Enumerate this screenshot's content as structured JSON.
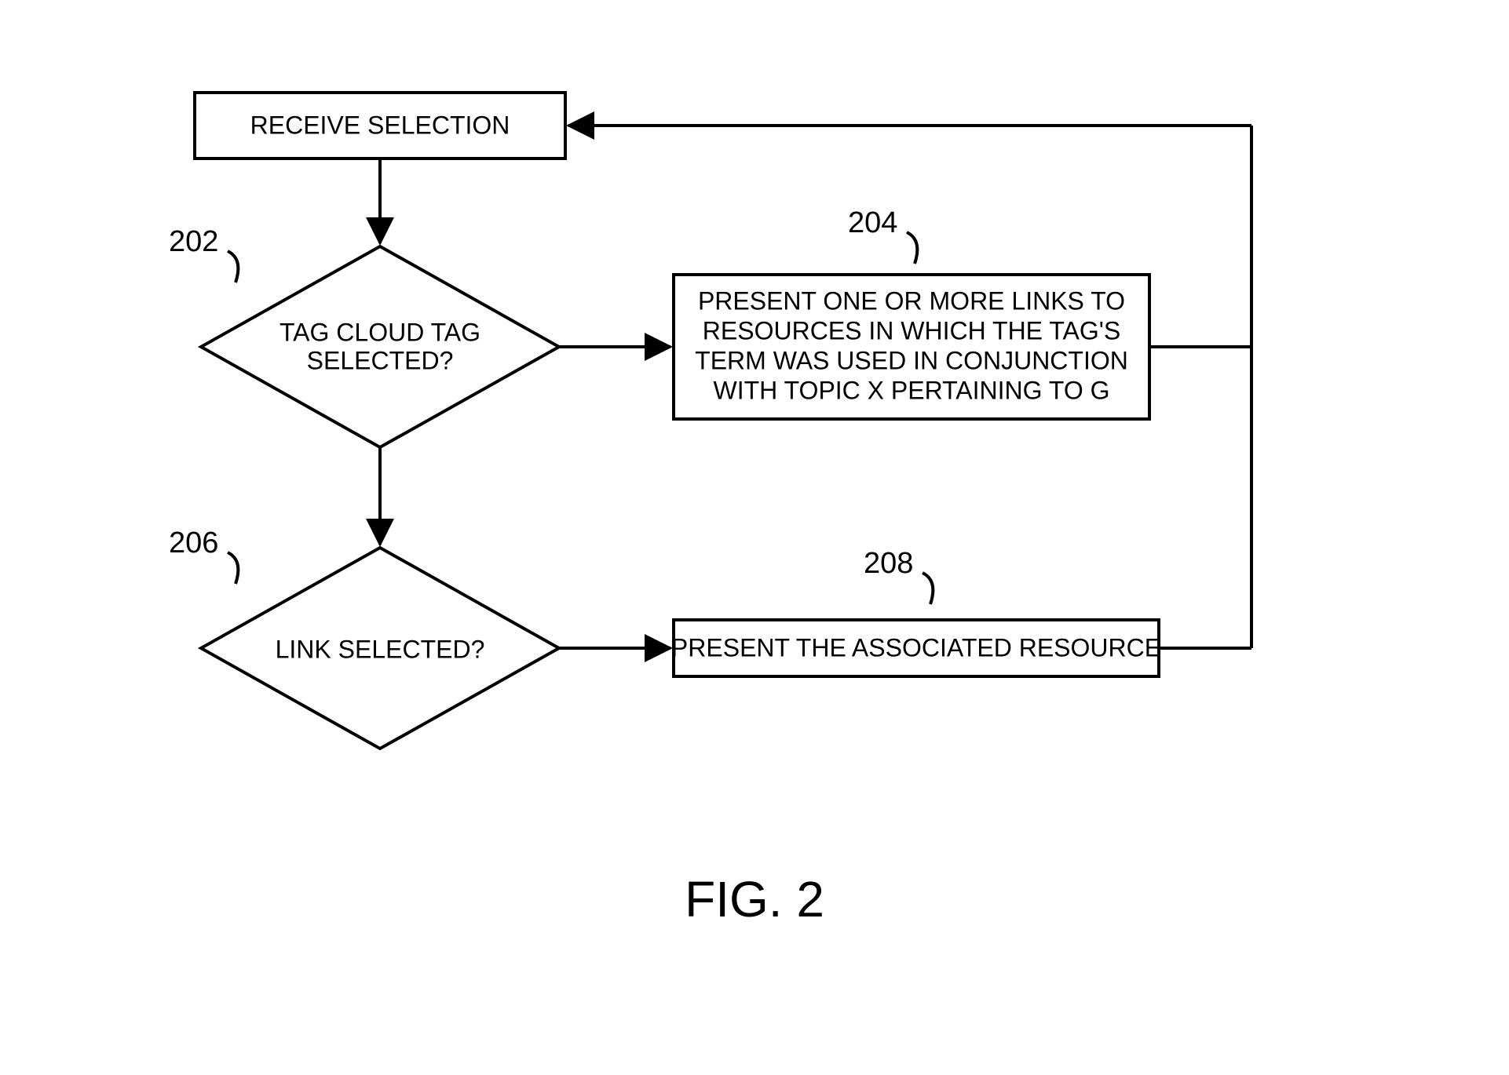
{
  "chart_data": {
    "type": "flowchart",
    "title": "FIG. 2",
    "nodes": [
      {
        "id": "receive",
        "shape": "rect",
        "text": "RECEIVE SELECTION"
      },
      {
        "id": "d202",
        "shape": "diamond",
        "label": "202",
        "text": "TAG CLOUD TAG SELECTED?"
      },
      {
        "id": "b204",
        "shape": "rect",
        "label": "204",
        "text": "PRESENT ONE OR MORE LINKS TO RESOURCES IN WHICH THE TAG'S TERM WAS USED IN CONJUNCTION WITH TOPIC X PERTAINING TO G"
      },
      {
        "id": "d206",
        "shape": "diamond",
        "label": "206",
        "text": "LINK SELECTED?"
      },
      {
        "id": "b208",
        "shape": "rect",
        "label": "208",
        "text": "PRESENT THE ASSOCIATED RESOURCE"
      }
    ],
    "edges": [
      {
        "from": "receive",
        "to": "d202"
      },
      {
        "from": "d202",
        "to": "b204",
        "dir": "right"
      },
      {
        "from": "d202",
        "to": "d206",
        "dir": "down"
      },
      {
        "from": "d206",
        "to": "b208",
        "dir": "right"
      },
      {
        "from": "b204",
        "to": "receive",
        "dir": "feedback"
      },
      {
        "from": "b208",
        "to": "receive",
        "dir": "feedback"
      }
    ]
  },
  "boxes": {
    "receive": "RECEIVE SELECTION",
    "d202_l1": "TAG CLOUD TAG",
    "d202_l2": "SELECTED?",
    "b204_l1": "PRESENT ONE OR MORE LINKS TO",
    "b204_l2": "RESOURCES IN WHICH THE TAG'S",
    "b204_l3": "TERM WAS USED IN CONJUNCTION",
    "b204_l4": "WITH TOPIC X PERTAINING TO G",
    "d206": "LINK SELECTED?",
    "b208": "PRESENT THE ASSOCIATED RESOURCE"
  },
  "labels": {
    "l202": "202",
    "l204": "204",
    "l206": "206",
    "l208": "208"
  },
  "figure": "FIG. 2"
}
